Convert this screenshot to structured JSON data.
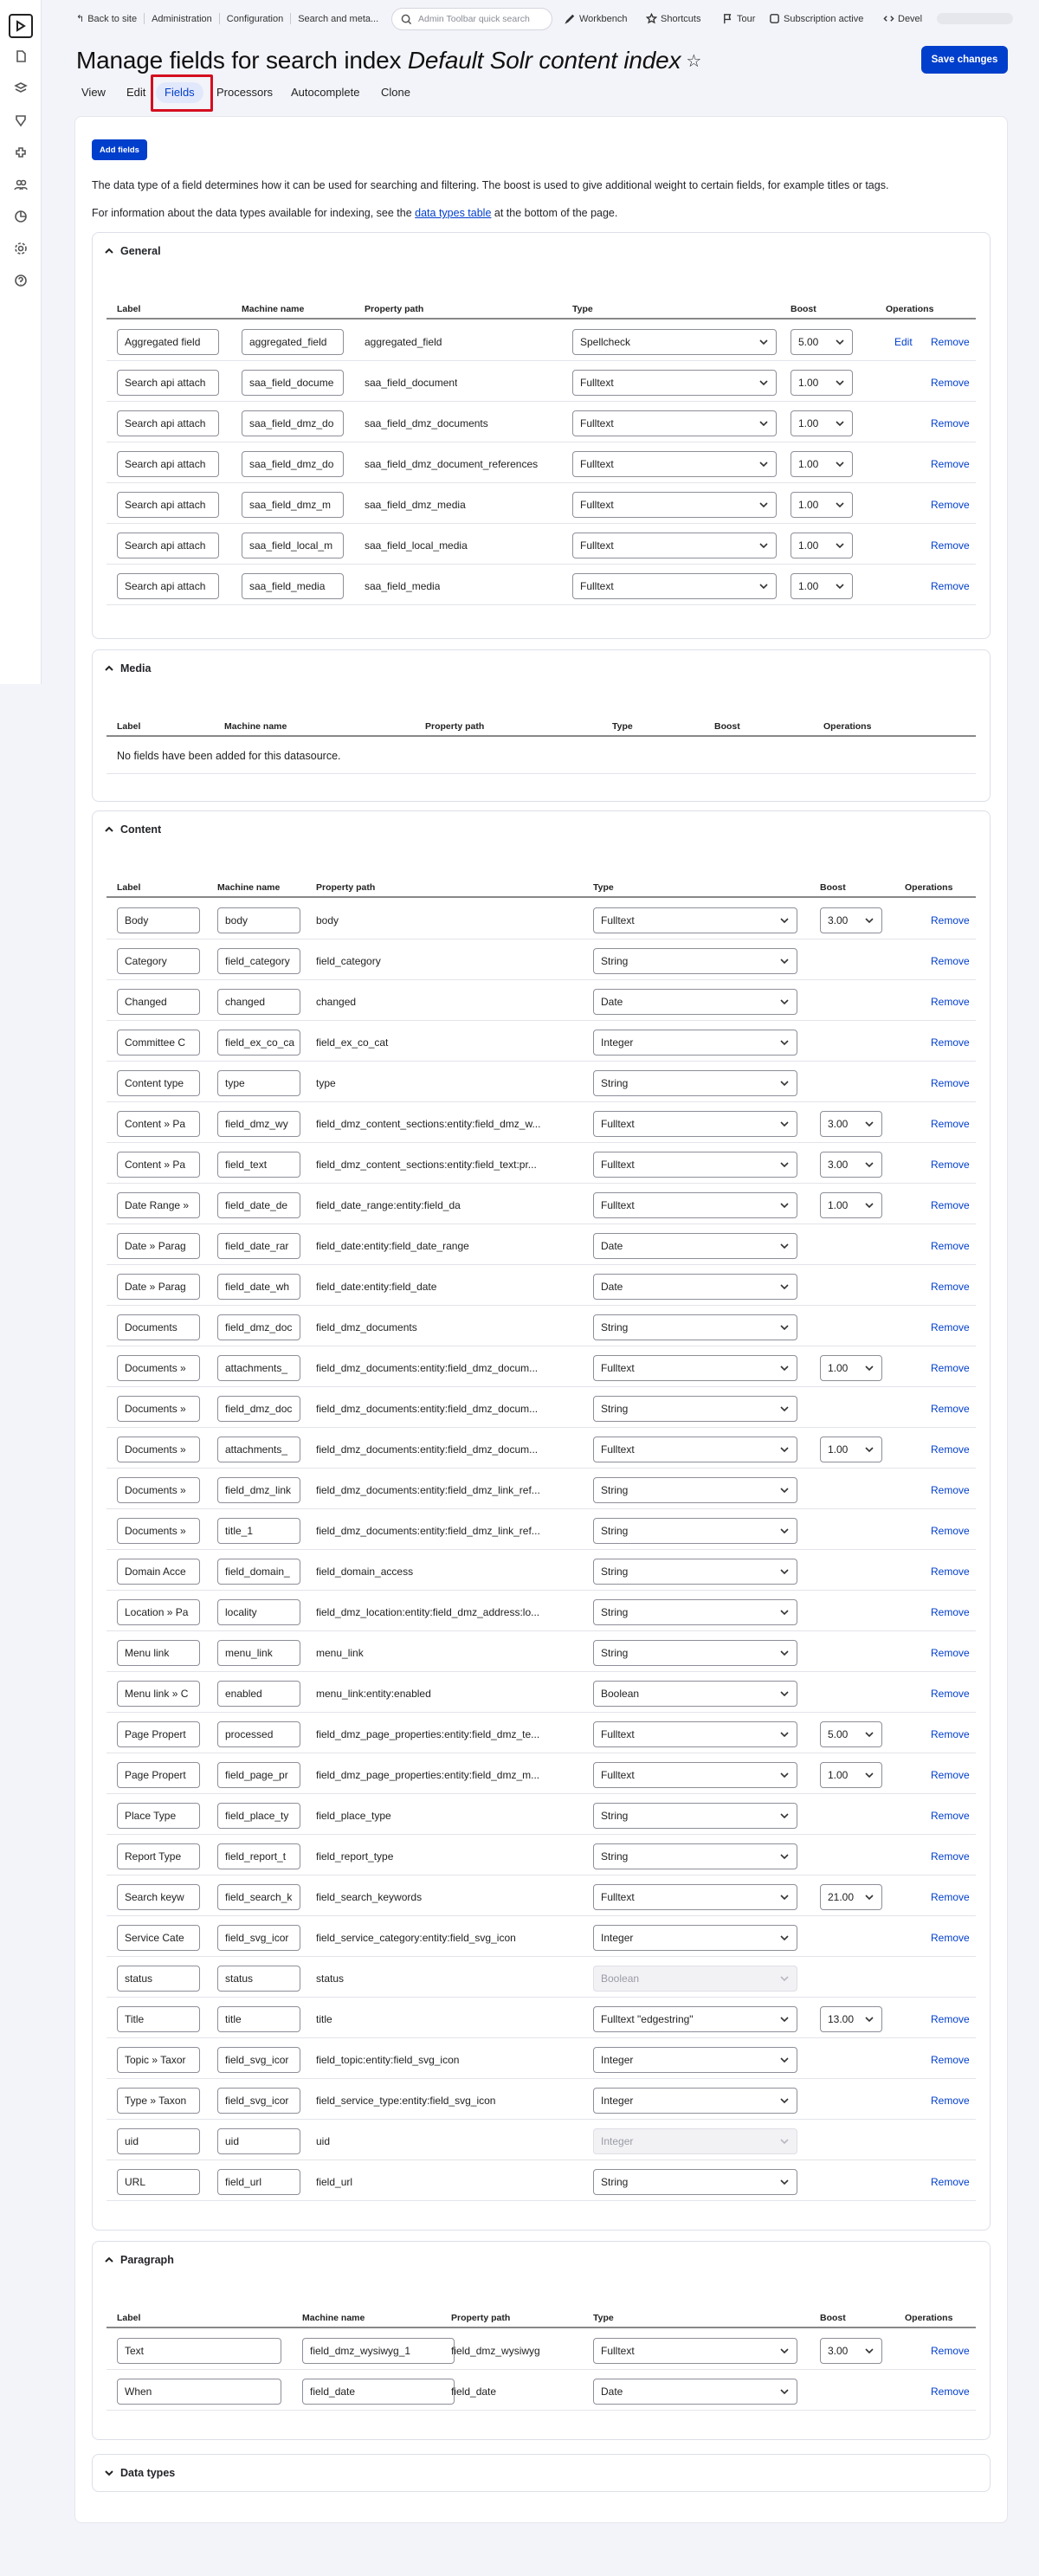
{
  "toolbar": {
    "breadcrumbs": [
      "Back to site",
      "Administration",
      "Configuration",
      "Search and meta..."
    ],
    "search_placeholder": "Admin Toolbar quick search",
    "workbench": "Workbench",
    "shortcuts": "Shortcuts",
    "tour": "Tour",
    "subscription": "Subscription active",
    "devel": "Devel"
  },
  "page": {
    "title_prefix": "Manage fields for search index ",
    "title_italic": "Default Solr content index",
    "save_label": "Save changes",
    "tabs": [
      "View",
      "Edit",
      "Fields",
      "Processors",
      "Autocomplete",
      "Clone"
    ],
    "add_fields_label": "Add fields",
    "intro": "The data type of a field determines how it can be used for searching and filtering. The boost is used to give additional weight to certain fields, for example titles or tags.",
    "info_before": "For information about the data types available for indexing, see the ",
    "info_link": "data types table",
    "info_after": " at the bottom of the page."
  },
  "headers": {
    "label": "Label",
    "machine": "Machine name",
    "path": "Property path",
    "type": "Type",
    "boost": "Boost",
    "ops": "Operations"
  },
  "general": {
    "legend": "General",
    "rows": [
      {
        "label": "Aggregated field",
        "machine": "aggregated_field",
        "path": "aggregated_field",
        "type": "Spellcheck",
        "boost": "5.00",
        "edit": "Edit",
        "remove": "Remove"
      },
      {
        "label": "Search api attach",
        "machine": "saa_field_docume",
        "path": "saa_field_document",
        "type": "Fulltext",
        "boost": "1.00",
        "remove": "Remove"
      },
      {
        "label": "Search api attach",
        "machine": "saa_field_dmz_do",
        "path": "saa_field_dmz_documents",
        "type": "Fulltext",
        "boost": "1.00",
        "remove": "Remove"
      },
      {
        "label": "Search api attach",
        "machine": "saa_field_dmz_do",
        "path": "saa_field_dmz_document_references",
        "type": "Fulltext",
        "boost": "1.00",
        "remove": "Remove"
      },
      {
        "label": "Search api attach",
        "machine": "saa_field_dmz_m",
        "path": "saa_field_dmz_media",
        "type": "Fulltext",
        "boost": "1.00",
        "remove": "Remove"
      },
      {
        "label": "Search api attach",
        "machine": "saa_field_local_m",
        "path": "saa_field_local_media",
        "type": "Fulltext",
        "boost": "1.00",
        "remove": "Remove"
      },
      {
        "label": "Search api attach",
        "machine": "saa_field_media",
        "path": "saa_field_media",
        "type": "Fulltext",
        "boost": "1.00",
        "remove": "Remove"
      }
    ]
  },
  "media": {
    "legend": "Media",
    "empty": "No fields have been added for this datasource."
  },
  "content": {
    "legend": "Content",
    "rows": [
      {
        "label": "Body",
        "machine": "body",
        "path": "body",
        "type": "Fulltext",
        "boost": "3.00",
        "remove": "Remove"
      },
      {
        "label": "Category",
        "machine": "field_category",
        "path": "field_category",
        "type": "String",
        "remove": "Remove"
      },
      {
        "label": "Changed",
        "machine": "changed",
        "path": "changed",
        "type": "Date",
        "remove": "Remove"
      },
      {
        "label": "Committee C",
        "machine": "field_ex_co_ca",
        "path": "field_ex_co_cat",
        "type": "Integer",
        "remove": "Remove"
      },
      {
        "label": "Content type",
        "machine": "type",
        "path": "type",
        "type": "String",
        "remove": "Remove"
      },
      {
        "label": "Content » Pa",
        "machine": "field_dmz_wy",
        "path": "field_dmz_content_sections:entity:field_dmz_w...",
        "type": "Fulltext",
        "boost": "3.00",
        "remove": "Remove"
      },
      {
        "label": "Content » Pa",
        "machine": "field_text",
        "path": "field_dmz_content_sections:entity:field_text:pr...",
        "type": "Fulltext",
        "boost": "3.00",
        "remove": "Remove"
      },
      {
        "label": "Date Range »",
        "machine": "field_date_de",
        "path": "field_date_range:entity:field_da",
        "type": "Fulltext",
        "boost": "1.00",
        "remove": "Remove"
      },
      {
        "label": "Date » Parag",
        "machine": "field_date_rar",
        "path": "field_date:entity:field_date_range",
        "type": "Date",
        "remove": "Remove"
      },
      {
        "label": "Date » Parag",
        "machine": "field_date_wh",
        "path": "field_date:entity:field_date",
        "type": "Date",
        "remove": "Remove"
      },
      {
        "label": "Documents",
        "machine": "field_dmz_doc",
        "path": "field_dmz_documents",
        "type": "String",
        "remove": "Remove"
      },
      {
        "label": "Documents »",
        "machine": "attachments_",
        "path": "field_dmz_documents:entity:field_dmz_docum...",
        "type": "Fulltext",
        "boost": "1.00",
        "remove": "Remove"
      },
      {
        "label": "Documents »",
        "machine": "field_dmz_doc",
        "path": "field_dmz_documents:entity:field_dmz_docum...",
        "type": "String",
        "remove": "Remove"
      },
      {
        "label": "Documents »",
        "machine": "attachments_",
        "path": "field_dmz_documents:entity:field_dmz_docum...",
        "type": "Fulltext",
        "boost": "1.00",
        "remove": "Remove"
      },
      {
        "label": "Documents »",
        "machine": "field_dmz_link",
        "path": "field_dmz_documents:entity:field_dmz_link_ref...",
        "type": "String",
        "remove": "Remove"
      },
      {
        "label": "Documents »",
        "machine": "title_1",
        "path": "field_dmz_documents:entity:field_dmz_link_ref...",
        "type": "String",
        "remove": "Remove"
      },
      {
        "label": "Domain Acce",
        "machine": "field_domain_",
        "path": "field_domain_access",
        "type": "String",
        "remove": "Remove"
      },
      {
        "label": "Location » Pa",
        "machine": "locality",
        "path": "field_dmz_location:entity:field_dmz_address:lo...",
        "type": "String",
        "remove": "Remove"
      },
      {
        "label": "Menu link",
        "machine": "menu_link",
        "path": "menu_link",
        "type": "String",
        "remove": "Remove"
      },
      {
        "label": "Menu link » C",
        "machine": "enabled",
        "path": "menu_link:entity:enabled",
        "type": "Boolean",
        "remove": "Remove"
      },
      {
        "label": "Page Propert",
        "machine": "processed",
        "path": "field_dmz_page_properties:entity:field_dmz_te...",
        "type": "Fulltext",
        "boost": "5.00",
        "remove": "Remove"
      },
      {
        "label": "Page Propert",
        "machine": "field_page_pr",
        "path": "field_dmz_page_properties:entity:field_dmz_m...",
        "type": "Fulltext",
        "boost": "1.00",
        "remove": "Remove"
      },
      {
        "label": "Place Type",
        "machine": "field_place_ty",
        "path": "field_place_type",
        "type": "String",
        "remove": "Remove"
      },
      {
        "label": "Report Type",
        "machine": "field_report_t",
        "path": "field_report_type",
        "type": "String",
        "remove": "Remove"
      },
      {
        "label": "Search keyw",
        "machine": "field_search_k",
        "path": "field_search_keywords",
        "type": "Fulltext",
        "boost": "21.00",
        "remove": "Remove"
      },
      {
        "label": "Service Cate",
        "machine": "field_svg_icor",
        "path": "field_service_category:entity:field_svg_icon",
        "type": "Integer",
        "remove": "Remove"
      },
      {
        "label": "status",
        "machine": "status",
        "path": "status",
        "type": "Boolean",
        "disabled": true
      },
      {
        "label": "Title",
        "machine": "title",
        "path": "title",
        "type": "Fulltext \"edgestring\"",
        "boost": "13.00",
        "remove": "Remove"
      },
      {
        "label": "Topic » Taxor",
        "machine": "field_svg_icor",
        "path": "field_topic:entity:field_svg_icon",
        "type": "Integer",
        "remove": "Remove"
      },
      {
        "label": "Type » Taxon",
        "machine": "field_svg_icor",
        "path": "field_service_type:entity:field_svg_icon",
        "type": "Integer",
        "remove": "Remove"
      },
      {
        "label": "uid",
        "machine": "uid",
        "path": "uid",
        "type": "Integer",
        "disabled": true
      },
      {
        "label": "URL",
        "machine": "field_url",
        "path": "field_url",
        "type": "String",
        "remove": "Remove"
      }
    ]
  },
  "paragraph": {
    "legend": "Paragraph",
    "rows": [
      {
        "label": "Text",
        "machine": "field_dmz_wysiwyg_1",
        "path": "field_dmz_wysiwyg",
        "type": "Fulltext",
        "boost": "3.00",
        "remove": "Remove"
      },
      {
        "label": "When",
        "machine": "field_date",
        "path": "field_date",
        "type": "Date",
        "remove": "Remove"
      }
    ]
  },
  "datatypes": {
    "legend": "Data types"
  }
}
